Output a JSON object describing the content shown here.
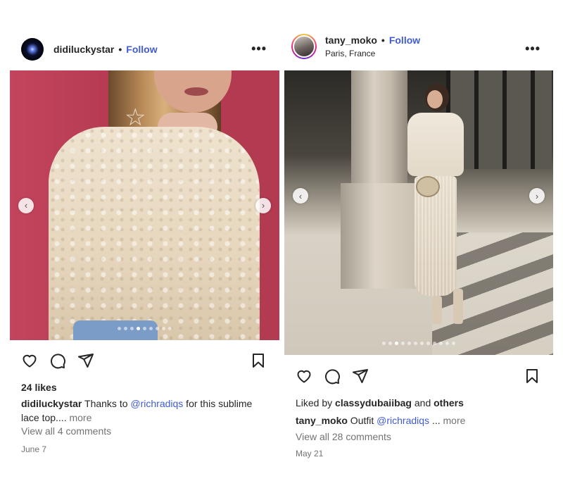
{
  "posts": [
    {
      "username": "didiluckystar",
      "follow_label": "Follow",
      "dot": "•",
      "more_menu": "•••",
      "likes": "24 likes",
      "caption_user": "didiluckystar",
      "caption_text": "Thanks to ",
      "caption_mention": "@richradiqs",
      "caption_rest": " for this sublime lace top....",
      "caption_more": "more",
      "comments": "View all 4 comments",
      "date": "June 7",
      "carousel": {
        "count": 9,
        "active": 3
      }
    },
    {
      "username": "tany_moko",
      "follow_label": "Follow",
      "dot": "•",
      "location": "Paris, France",
      "more_menu": "•••",
      "liked_prefix": "Liked by ",
      "liked_user": "classydubaiibag",
      "liked_mid": " and ",
      "liked_others": "others",
      "caption_user": "tany_moko",
      "caption_text": " Outfit ",
      "caption_mention": "@richradiqs",
      "caption_rest": " ...",
      "caption_more": "more",
      "comments": "View all 28 comments",
      "date": "May 21",
      "carousel": {
        "count": 12,
        "active": 2
      }
    }
  ],
  "colors": {
    "link": "#3f5bd6",
    "muted": "#737373",
    "text": "#262626"
  },
  "icons": [
    "heart-icon",
    "comment-icon",
    "share-icon",
    "bookmark-icon",
    "chevron-left-icon",
    "chevron-right-icon",
    "more-icon"
  ]
}
